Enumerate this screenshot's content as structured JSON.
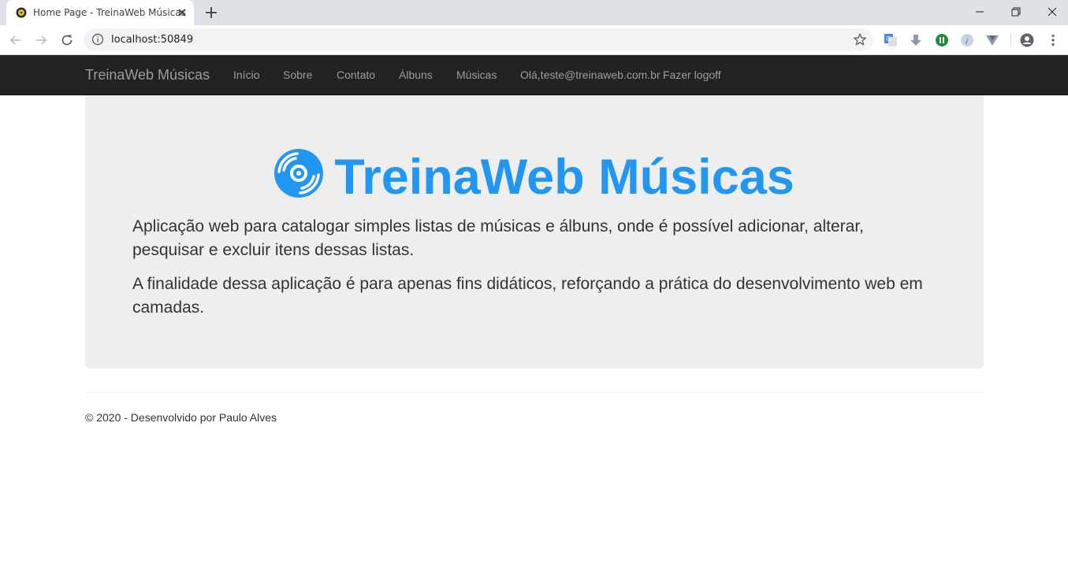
{
  "browser": {
    "tab_title": "Home Page - TreinaWeb Músicas",
    "url": "localhost:50849",
    "icons": {
      "favicon": "music-disc-icon",
      "close": "close-icon",
      "new_tab": "plus-icon",
      "back": "arrow-left-icon",
      "forward": "arrow-right-icon",
      "reload": "reload-icon",
      "info": "info-icon",
      "bookmark": "star-icon",
      "profile": "account-circle-icon",
      "menu": "kebab-menu-icon"
    }
  },
  "navbar": {
    "brand": "TreinaWeb Músicas",
    "links": [
      "Início",
      "Sobre",
      "Contato",
      "Álbuns",
      "Músicas"
    ],
    "greeting": "Olá,teste@treinaweb.com.br",
    "logoff": "Fazer logoff"
  },
  "jumbotron": {
    "icon": "music-disc-icon",
    "heading": "TreinaWeb Músicas",
    "lead1": "Aplicação web para catalogar simples listas de músicas e álbuns, onde é possível adicionar, alterar, pesquisar e excluir itens dessas listas.",
    "lead2": "A finalidade dessa aplicação é para apenas fins didáticos, reforçando a prática do desenvolvimento web em camadas."
  },
  "footer": {
    "text": "© 2020 - Desenvolvido por Paulo Alves"
  },
  "colors": {
    "accent": "#2196f3",
    "navbar_bg": "#222222",
    "navbar_text": "#9d9d9d",
    "jumbotron_bg": "#eeeeee"
  }
}
